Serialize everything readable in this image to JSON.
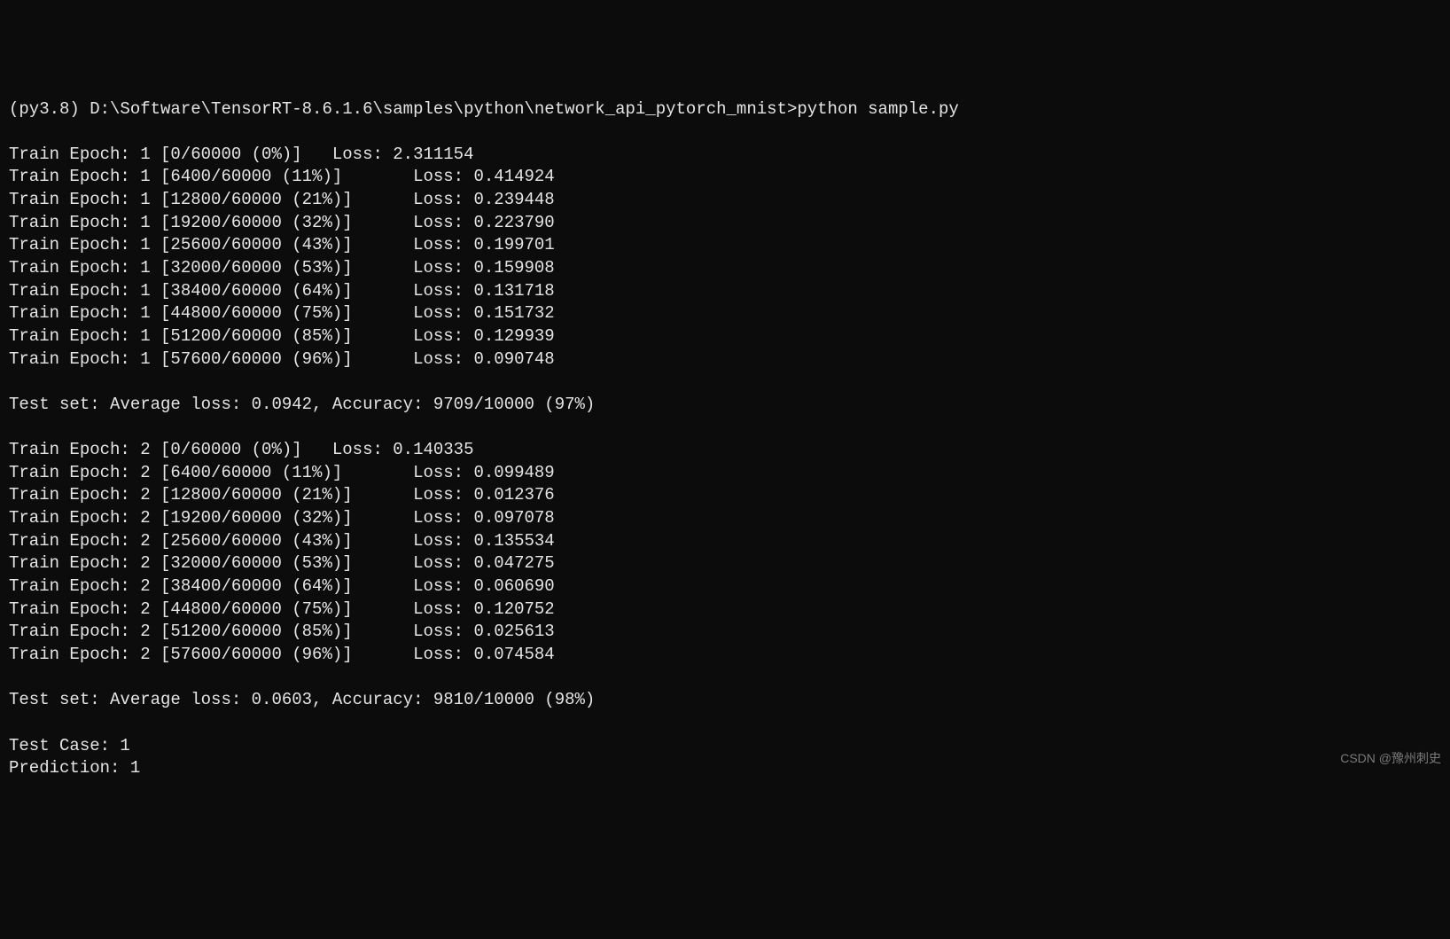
{
  "prompt": "(py3.8) D:\\Software\\TensorRT-8.6.1.6\\samples\\python\\network_api_pytorch_mnist>python sample.py",
  "lines": [
    "Train Epoch: 1 [0/60000 (0%)]   Loss: 2.311154",
    "Train Epoch: 1 [6400/60000 (11%)]       Loss: 0.414924",
    "Train Epoch: 1 [12800/60000 (21%)]      Loss: 0.239448",
    "Train Epoch: 1 [19200/60000 (32%)]      Loss: 0.223790",
    "Train Epoch: 1 [25600/60000 (43%)]      Loss: 0.199701",
    "Train Epoch: 1 [32000/60000 (53%)]      Loss: 0.159908",
    "Train Epoch: 1 [38400/60000 (64%)]      Loss: 0.131718",
    "Train Epoch: 1 [44800/60000 (75%)]      Loss: 0.151732",
    "Train Epoch: 1 [51200/60000 (85%)]      Loss: 0.129939",
    "Train Epoch: 1 [57600/60000 (96%)]      Loss: 0.090748",
    "",
    "Test set: Average loss: 0.0942, Accuracy: 9709/10000 (97%)",
    "",
    "Train Epoch: 2 [0/60000 (0%)]   Loss: 0.140335",
    "Train Epoch: 2 [6400/60000 (11%)]       Loss: 0.099489",
    "Train Epoch: 2 [12800/60000 (21%)]      Loss: 0.012376",
    "Train Epoch: 2 [19200/60000 (32%)]      Loss: 0.097078",
    "Train Epoch: 2 [25600/60000 (43%)]      Loss: 0.135534",
    "Train Epoch: 2 [32000/60000 (53%)]      Loss: 0.047275",
    "Train Epoch: 2 [38400/60000 (64%)]      Loss: 0.060690",
    "Train Epoch: 2 [44800/60000 (75%)]      Loss: 0.120752",
    "Train Epoch: 2 [51200/60000 (85%)]      Loss: 0.025613",
    "Train Epoch: 2 [57600/60000 (96%)]      Loss: 0.074584",
    "",
    "Test set: Average loss: 0.0603, Accuracy: 9810/10000 (98%)",
    "",
    "Test Case: 1",
    "Prediction: 1"
  ],
  "watermark": "CSDN @豫州刺史"
}
